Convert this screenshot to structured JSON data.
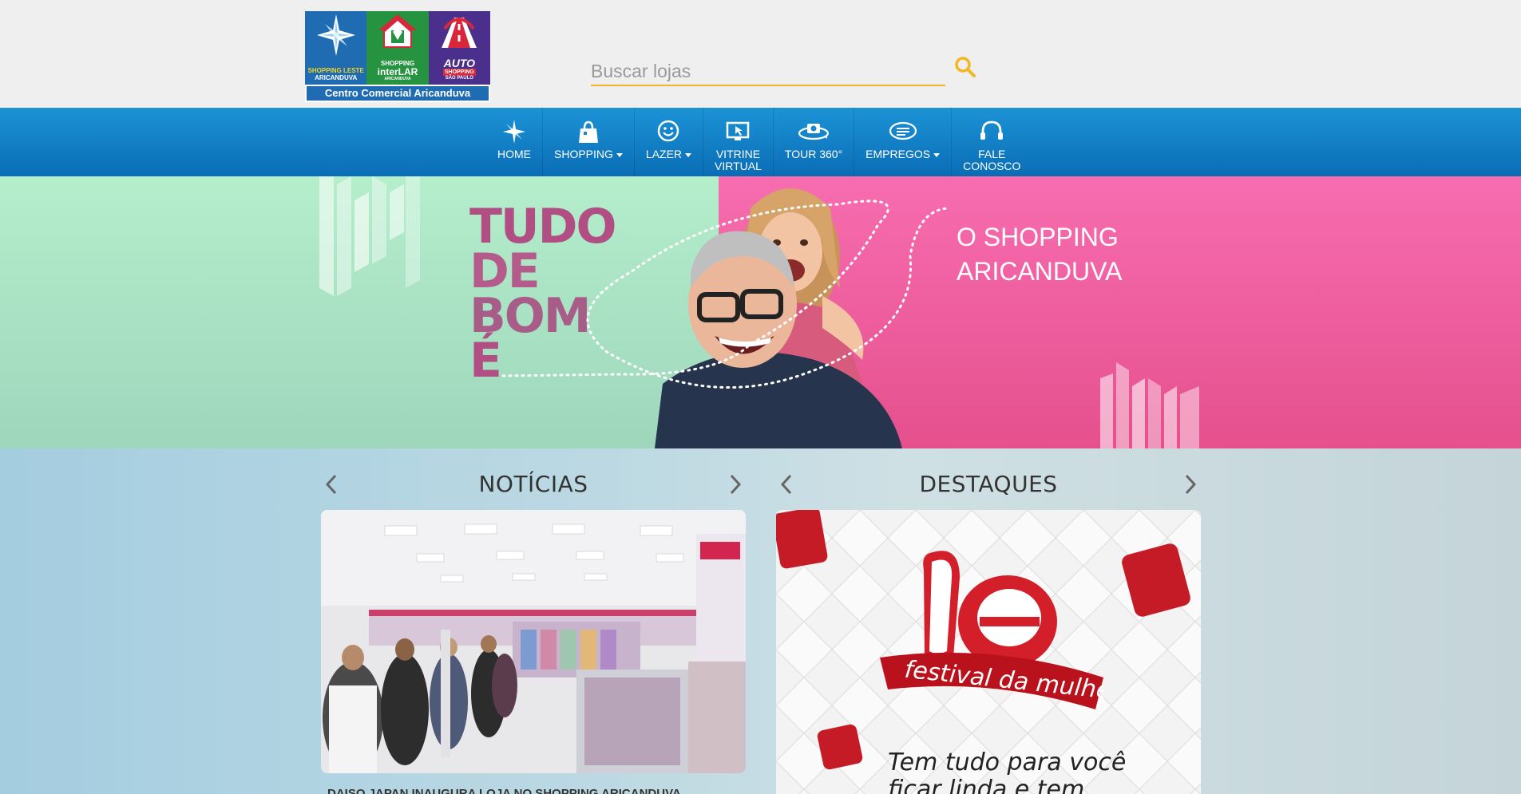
{
  "header": {
    "logo": {
      "shopping_leste_line1": "SHOPPING LESTE",
      "shopping_leste_line2": "ARICANDUVA",
      "interlar_line1": "SHOPPING",
      "interlar_line2": "interLAR",
      "interlar_line3": "ARICANDUVA",
      "auto_line1": "AUTO",
      "auto_line2": "SHOPPING",
      "auto_line3": "SÃO PAULO",
      "caption": "Centro Comercial Aricanduva"
    },
    "search": {
      "placeholder": "Buscar lojas",
      "value": ""
    }
  },
  "nav": {
    "items": [
      {
        "label": "HOME",
        "icon": "star-icon",
        "dropdown": false
      },
      {
        "label": "SHOPPING",
        "icon": "shopping-bag-icon",
        "dropdown": true
      },
      {
        "label": "LAZER",
        "icon": "smiley-icon",
        "dropdown": true
      },
      {
        "label_line1": "VITRINE",
        "label_line2": "VIRTUAL",
        "icon": "monitor-cursor-icon",
        "dropdown": false
      },
      {
        "label": "TOUR 360°",
        "icon": "camera-360-icon",
        "dropdown": false
      },
      {
        "label": "EMPREGOS",
        "icon": "chat-lines-icon",
        "dropdown": true
      },
      {
        "label_line1": "FALE",
        "label_line2": "CONOSCO",
        "icon": "headset-icon",
        "dropdown": false
      }
    ]
  },
  "hero": {
    "title_lines": [
      "TUDO",
      "DE",
      "BOM",
      "É"
    ],
    "subtitle_line1": "O SHOPPING",
    "subtitle_line2": "ARICANDUVA"
  },
  "news": {
    "title": "NOTÍCIAS",
    "caption": "DAISO JAPAN INAUGURA LOJA NO SHOPPING ARICANDUVA"
  },
  "highlights": {
    "title": "DESTAQUES",
    "logo_text": "le",
    "ribbon_text": "festival da mulher",
    "text_line1": "Tem tudo para você",
    "text_line2": "ficar linda e tem"
  },
  "colors": {
    "nav_blue": "#0a6db6",
    "search_accent": "#f3b624",
    "hero_green": "#b3ecc9",
    "hero_pink": "#f064a2",
    "hero_title": "#b14f85",
    "festival_red": "#d21f2a"
  }
}
